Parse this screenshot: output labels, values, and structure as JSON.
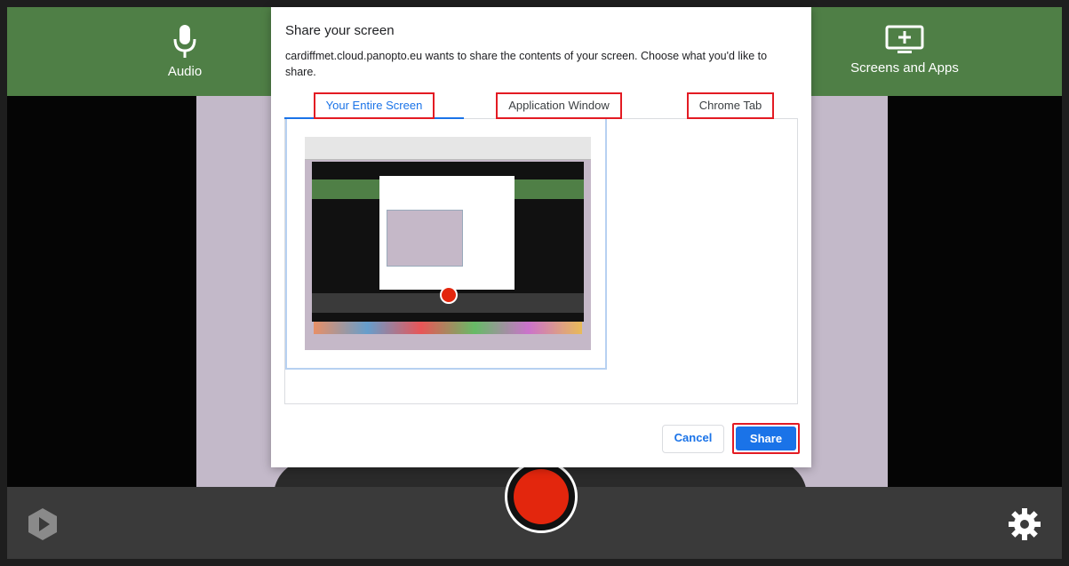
{
  "topbar": {
    "audio_label": "Audio",
    "screens_label": "Screens and Apps",
    "bg_color": "#4f7f46"
  },
  "dialog": {
    "title": "Share your screen",
    "subtitle": "cardiffmet.cloud.panopto.eu wants to share the contents of your screen. Choose what you'd like to share.",
    "tabs": [
      {
        "label": "Your Entire Screen",
        "active": true
      },
      {
        "label": "Application Window",
        "active": false
      },
      {
        "label": "Chrome Tab",
        "active": false
      }
    ],
    "cancel_label": "Cancel",
    "share_label": "Share",
    "accent_color": "#1a73e8",
    "highlight_color": "#e31b23"
  },
  "controls": {
    "record_color": "#e3260d",
    "logo_icon": "panopto-logo-icon",
    "settings_icon": "gear-icon"
  }
}
